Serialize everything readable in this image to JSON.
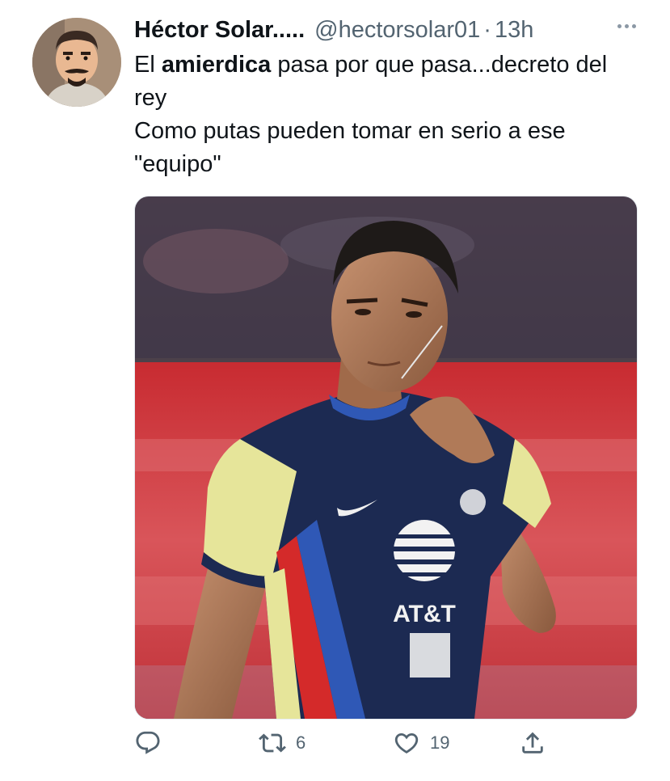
{
  "tweet": {
    "author": {
      "display_name": "Héctor Solar.....",
      "handle": "@hectorsolar01",
      "separator": "·",
      "time": "13h"
    },
    "text": {
      "line1_prefix": "El ",
      "line1_bold": "amierdica",
      "line1_suffix": " pasa por que pasa...decreto del rey",
      "line2": "Como putas pueden tomar en serio a ese \"equipo\""
    },
    "media": {
      "jersey_text": "AT&T"
    },
    "actions": {
      "reply": {
        "icon": "reply-icon",
        "count": ""
      },
      "retweet": {
        "icon": "retweet-icon",
        "count": "6"
      },
      "like": {
        "icon": "heart-icon",
        "count": "19"
      },
      "share": {
        "icon": "share-icon",
        "count": ""
      }
    }
  },
  "colors": {
    "text_primary": "#0f1419",
    "text_secondary": "#536471",
    "jersey_navy": "#1c2a52",
    "jersey_yellow": "#e6e59a",
    "jersey_red": "#d42a2a",
    "jersey_blue": "#2f58b6",
    "background_red": "#c0272f"
  }
}
